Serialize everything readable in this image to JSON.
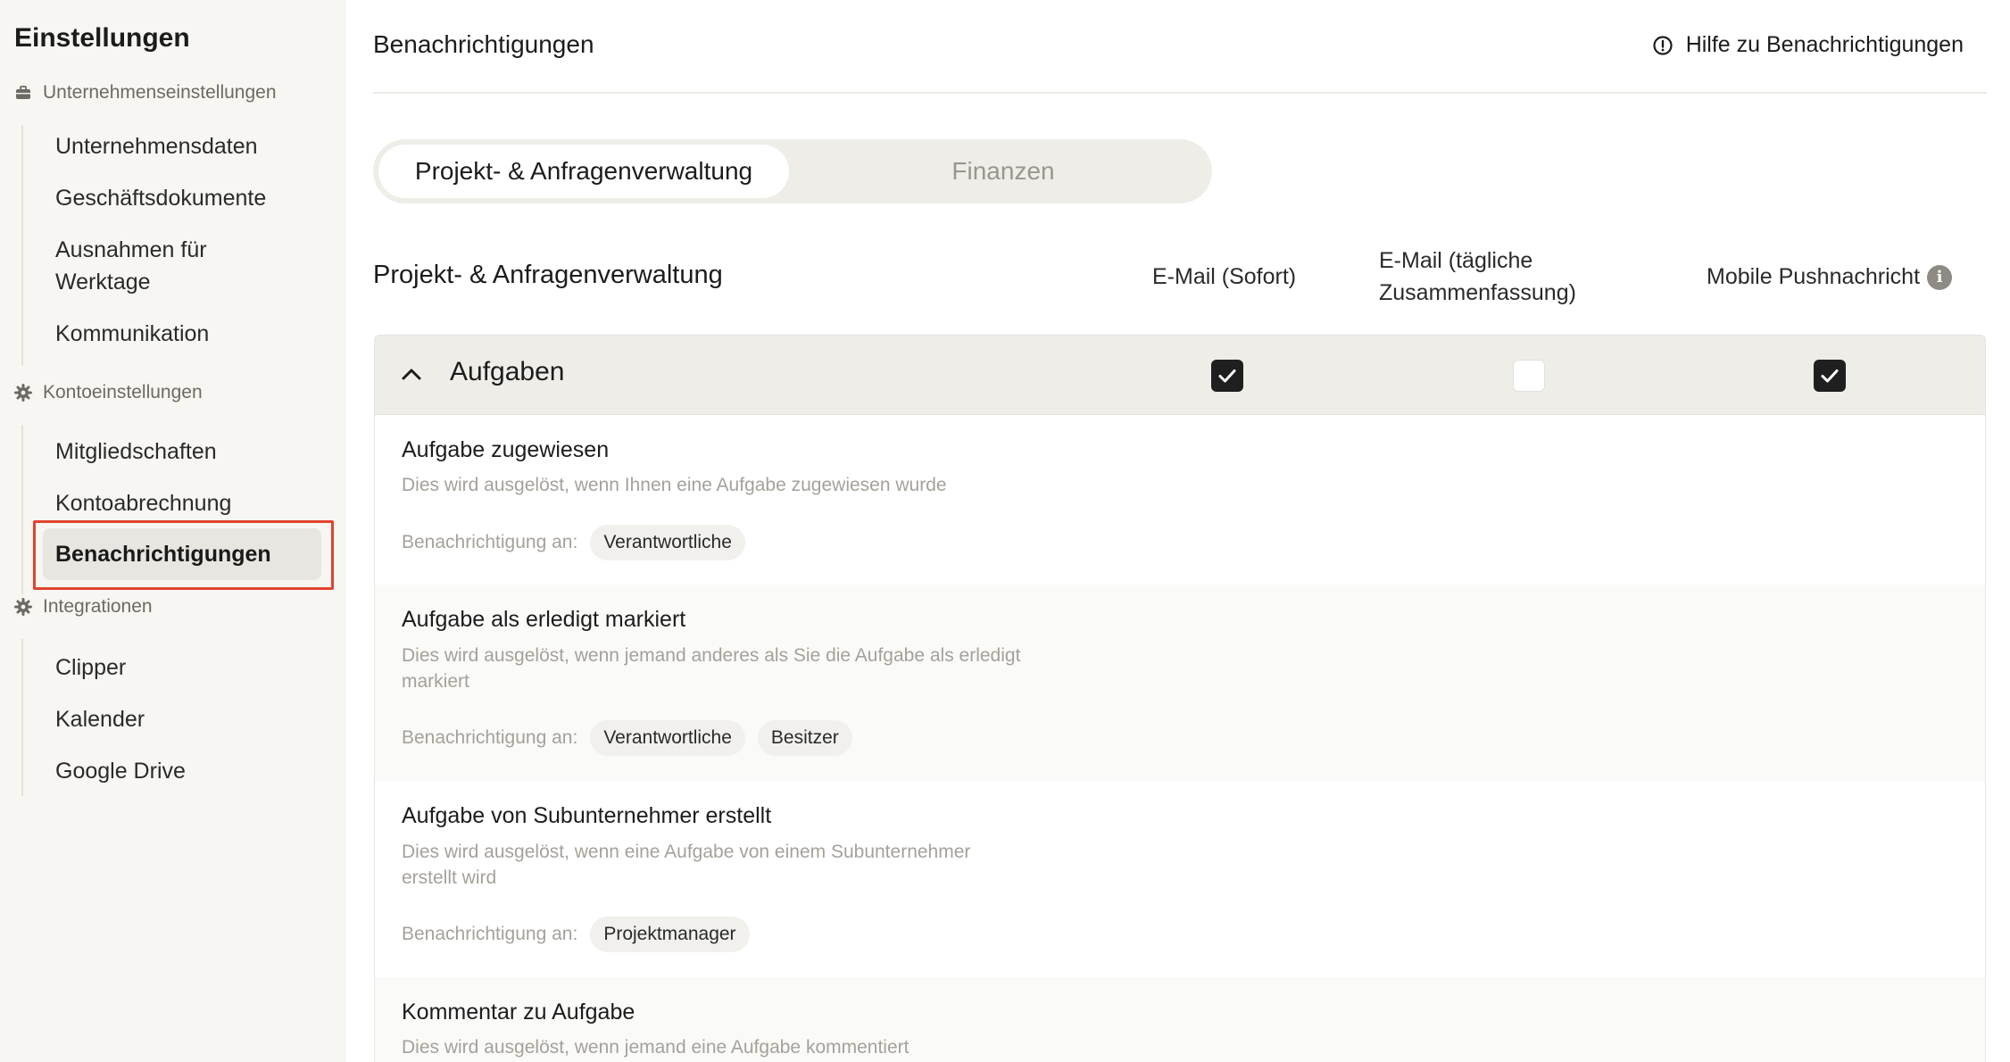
{
  "sidebar": {
    "title": "Einstellungen",
    "sections": [
      {
        "label": "Unternehmenseinstellungen",
        "icon": "briefcase-icon",
        "items": [
          "Unternehmensdaten",
          "Geschäftsdokumente",
          "Ausnahmen für Werktage",
          "Kommunikation"
        ]
      },
      {
        "label": "Kontoeinstellungen",
        "icon": "gear-icon",
        "items": [
          "Mitgliedschaften",
          "Kontoabrechnung",
          "Benachrichtigungen"
        ]
      },
      {
        "label": "Integrationen",
        "icon": "gear-icon",
        "items": [
          "Clipper",
          "Kalender",
          "Google Drive"
        ]
      }
    ],
    "active_item": "Benachrichtigungen"
  },
  "header": {
    "title": "Benachrichtigungen",
    "help_label": "Hilfe zu Benachrichtigungen"
  },
  "tabs": [
    {
      "label": "Projekt- & Anfragenverwaltung",
      "active": true
    },
    {
      "label": "Finanzen",
      "active": false
    }
  ],
  "columns": {
    "section_title": "Projekt- & Anfragenverwaltung",
    "email_instant": "E-Mail (Sofort)",
    "email_digest_line1": "E-Mail (tägliche",
    "email_digest_line2": "Zusammenfassung)",
    "mobile_push": "Mobile Pushnachricht"
  },
  "group": {
    "label": "Aufgaben",
    "email_instant": true,
    "email_digest": false,
    "mobile_push": true
  },
  "recipients_label": "Benachrichtigung an:",
  "rows": [
    {
      "title": "Aufgabe zugewiesen",
      "desc_line1": "Dies wird ausgelöst, wenn Ihnen eine Aufgabe zugewiesen wurde",
      "desc_line2": "",
      "chips": [
        "Verantwortliche"
      ]
    },
    {
      "title": "Aufgabe als erledigt markiert",
      "desc_line1": "Dies wird ausgelöst, wenn jemand anderes als Sie die Aufgabe als erledigt",
      "desc_line2": "markiert",
      "chips": [
        "Verantwortliche",
        "Besitzer"
      ]
    },
    {
      "title": "Aufgabe von Subunternehmer erstellt",
      "desc_line1": "Dies wird ausgelöst, wenn eine Aufgabe von einem Subunternehmer",
      "desc_line2": "erstellt wird",
      "chips": [
        "Projektmanager"
      ]
    },
    {
      "title": "Kommentar zu Aufgabe",
      "desc_line1": "Dies wird ausgelöst, wenn jemand eine Aufgabe kommentiert",
      "desc_line2": "",
      "chips": []
    }
  ]
}
